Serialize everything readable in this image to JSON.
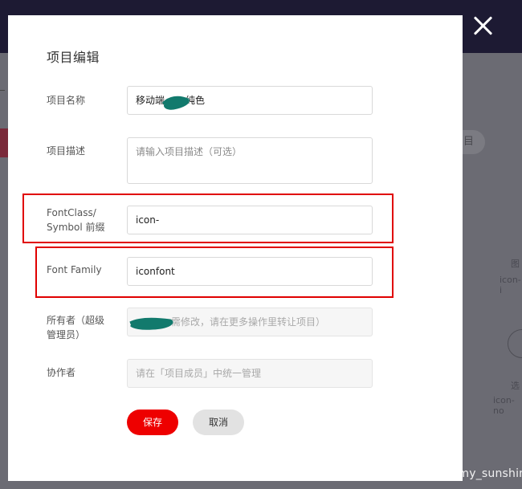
{
  "background": {
    "pill_label": "目",
    "right_labels": [
      "图",
      "icon-i",
      "选",
      "icon-no"
    ]
  },
  "modal": {
    "title": "项目编辑",
    "fields": {
      "name": {
        "label": "项目名称",
        "value": "移动端",
        "value_tail": "纯色"
      },
      "description": {
        "label": "项目描述",
        "placeholder": "请输入项目描述（可选）"
      },
      "prefix": {
        "label_line1": "FontClass/",
        "label_line2": "Symbol 前缀",
        "value": "icon-"
      },
      "font_family": {
        "label": "Font Family",
        "value": "iconfont"
      },
      "owner": {
        "label_line1": "所有者（超级",
        "label_line2": "管理员）",
        "value": "需修改，请在更多操作里转让项目）"
      },
      "collaborators": {
        "label": "协作者",
        "value": "请在「项目成员」中统一管理"
      }
    },
    "buttons": {
      "save": "保存",
      "cancel": "取消"
    }
  },
  "watermark": "https://blog.csdn.net/summer_my_sunshine",
  "colors": {
    "primary": "#ee0000",
    "highlight_box": "#e00000",
    "overlay_header": "#1d1a33"
  },
  "icons": [
    "close-icon"
  ]
}
